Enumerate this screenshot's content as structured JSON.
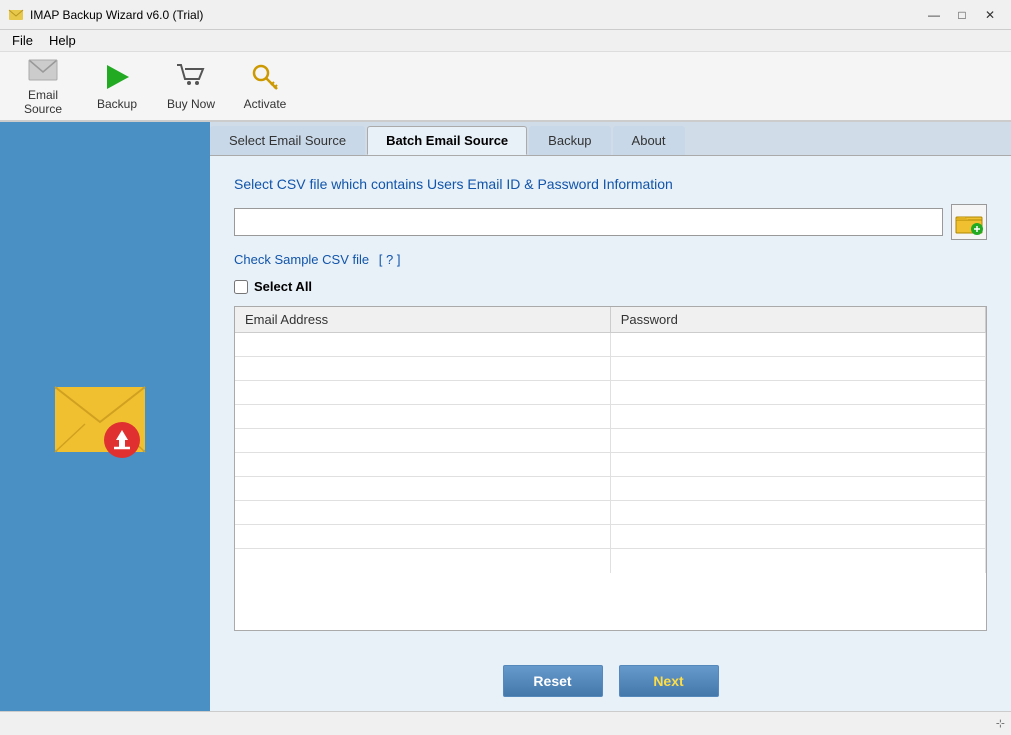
{
  "window": {
    "title": "IMAP Backup Wizard v6.0 (Trial)"
  },
  "menu": {
    "items": [
      "File",
      "Help"
    ]
  },
  "toolbar": {
    "buttons": [
      {
        "id": "email-source",
        "label": "Email Source"
      },
      {
        "id": "backup",
        "label": "Backup"
      },
      {
        "id": "buy-now",
        "label": "Buy Now"
      },
      {
        "id": "activate",
        "label": "Activate"
      }
    ]
  },
  "tabs": [
    {
      "id": "select-email-source",
      "label": "Select Email Source",
      "active": false
    },
    {
      "id": "batch-email-source",
      "label": "Batch Email Source",
      "active": true
    },
    {
      "id": "backup",
      "label": "Backup",
      "active": false
    },
    {
      "id": "about",
      "label": "About",
      "active": false
    }
  ],
  "content": {
    "section_title": "Select CSV file which contains Users Email ID & Password Information",
    "file_input_placeholder": "",
    "sample_link_text": "Check Sample CSV file",
    "help_link_text": "[ ? ]",
    "select_all_label": "Select All",
    "table": {
      "columns": [
        "Email Address",
        "Password"
      ],
      "rows": [
        [
          "",
          ""
        ],
        [
          "",
          ""
        ],
        [
          "",
          ""
        ],
        [
          "",
          ""
        ],
        [
          "",
          ""
        ],
        [
          "",
          ""
        ],
        [
          "",
          ""
        ],
        [
          "",
          ""
        ],
        [
          "",
          ""
        ],
        [
          "",
          ""
        ]
      ]
    }
  },
  "footer": {
    "reset_label": "Reset",
    "next_label": "Next"
  },
  "status_bar": {
    "resize_hint": "⊹"
  }
}
